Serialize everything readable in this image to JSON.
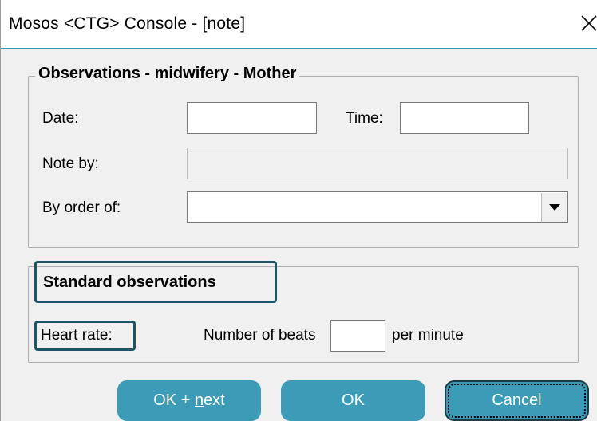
{
  "window": {
    "title": "Mosos <CTG> Console - [note]"
  },
  "observations": {
    "legend": "Observations - midwifery - Mother",
    "date_label": "Date:",
    "date_value": "",
    "time_label": "Time:",
    "time_value": "",
    "note_by_label": "Note by:",
    "note_by_value": "",
    "by_order_label": "By order of:",
    "by_order_value": ""
  },
  "standard": {
    "heading": "Standard observations",
    "heart_rate_label": "Heart rate:",
    "beats_label": "Number of beats",
    "beats_value": "",
    "per_minute_label": "per minute"
  },
  "buttons": {
    "ok_next_pre": "OK + ",
    "ok_next_mnemonic": "n",
    "ok_next_post": "ext",
    "ok_label": "OK",
    "cancel_label": "Cancel"
  },
  "colors": {
    "title_accent": "#2f9ac2",
    "button_bg": "#3c9cb8",
    "highlight_border": "#1e5566"
  },
  "icons": {
    "close": "close-icon",
    "dropdown": "chevron-down-icon"
  }
}
